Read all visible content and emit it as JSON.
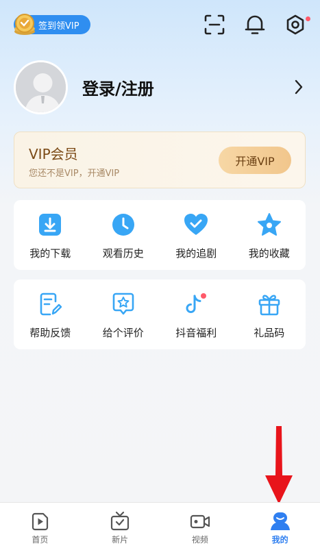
{
  "header": {
    "signin_label": "签到领VIP"
  },
  "profile": {
    "login_label": "登录/注册"
  },
  "vip": {
    "title": "VIP会员",
    "subtitle": "您还不是VIP，开通VIP",
    "button_label": "开通VIP"
  },
  "quick_actions": [
    {
      "label": "我的下载",
      "icon": "download-icon"
    },
    {
      "label": "观看历史",
      "icon": "clock-icon"
    },
    {
      "label": "我的追剧",
      "icon": "heart-check-icon"
    },
    {
      "label": "我的收藏",
      "icon": "star-icon"
    }
  ],
  "services": [
    {
      "label": "帮助反馈",
      "icon": "feedback-icon"
    },
    {
      "label": "给个评价",
      "icon": "rate-icon"
    },
    {
      "label": "抖音福利",
      "icon": "douyin-icon"
    },
    {
      "label": "礼品码",
      "icon": "gift-icon"
    }
  ],
  "tabs": [
    {
      "label": "首页",
      "icon": "play-tab-icon"
    },
    {
      "label": "新片",
      "icon": "tv-tab-icon"
    },
    {
      "label": "视频",
      "icon": "video-tab-icon"
    },
    {
      "label": "我的",
      "icon": "user-tab-icon",
      "active": true
    }
  ],
  "colors": {
    "accent": "#2f8ef0",
    "vip_text": "#7b4a16",
    "badge_dot": "#ff5a6a",
    "annotation_arrow": "#e8141b"
  }
}
